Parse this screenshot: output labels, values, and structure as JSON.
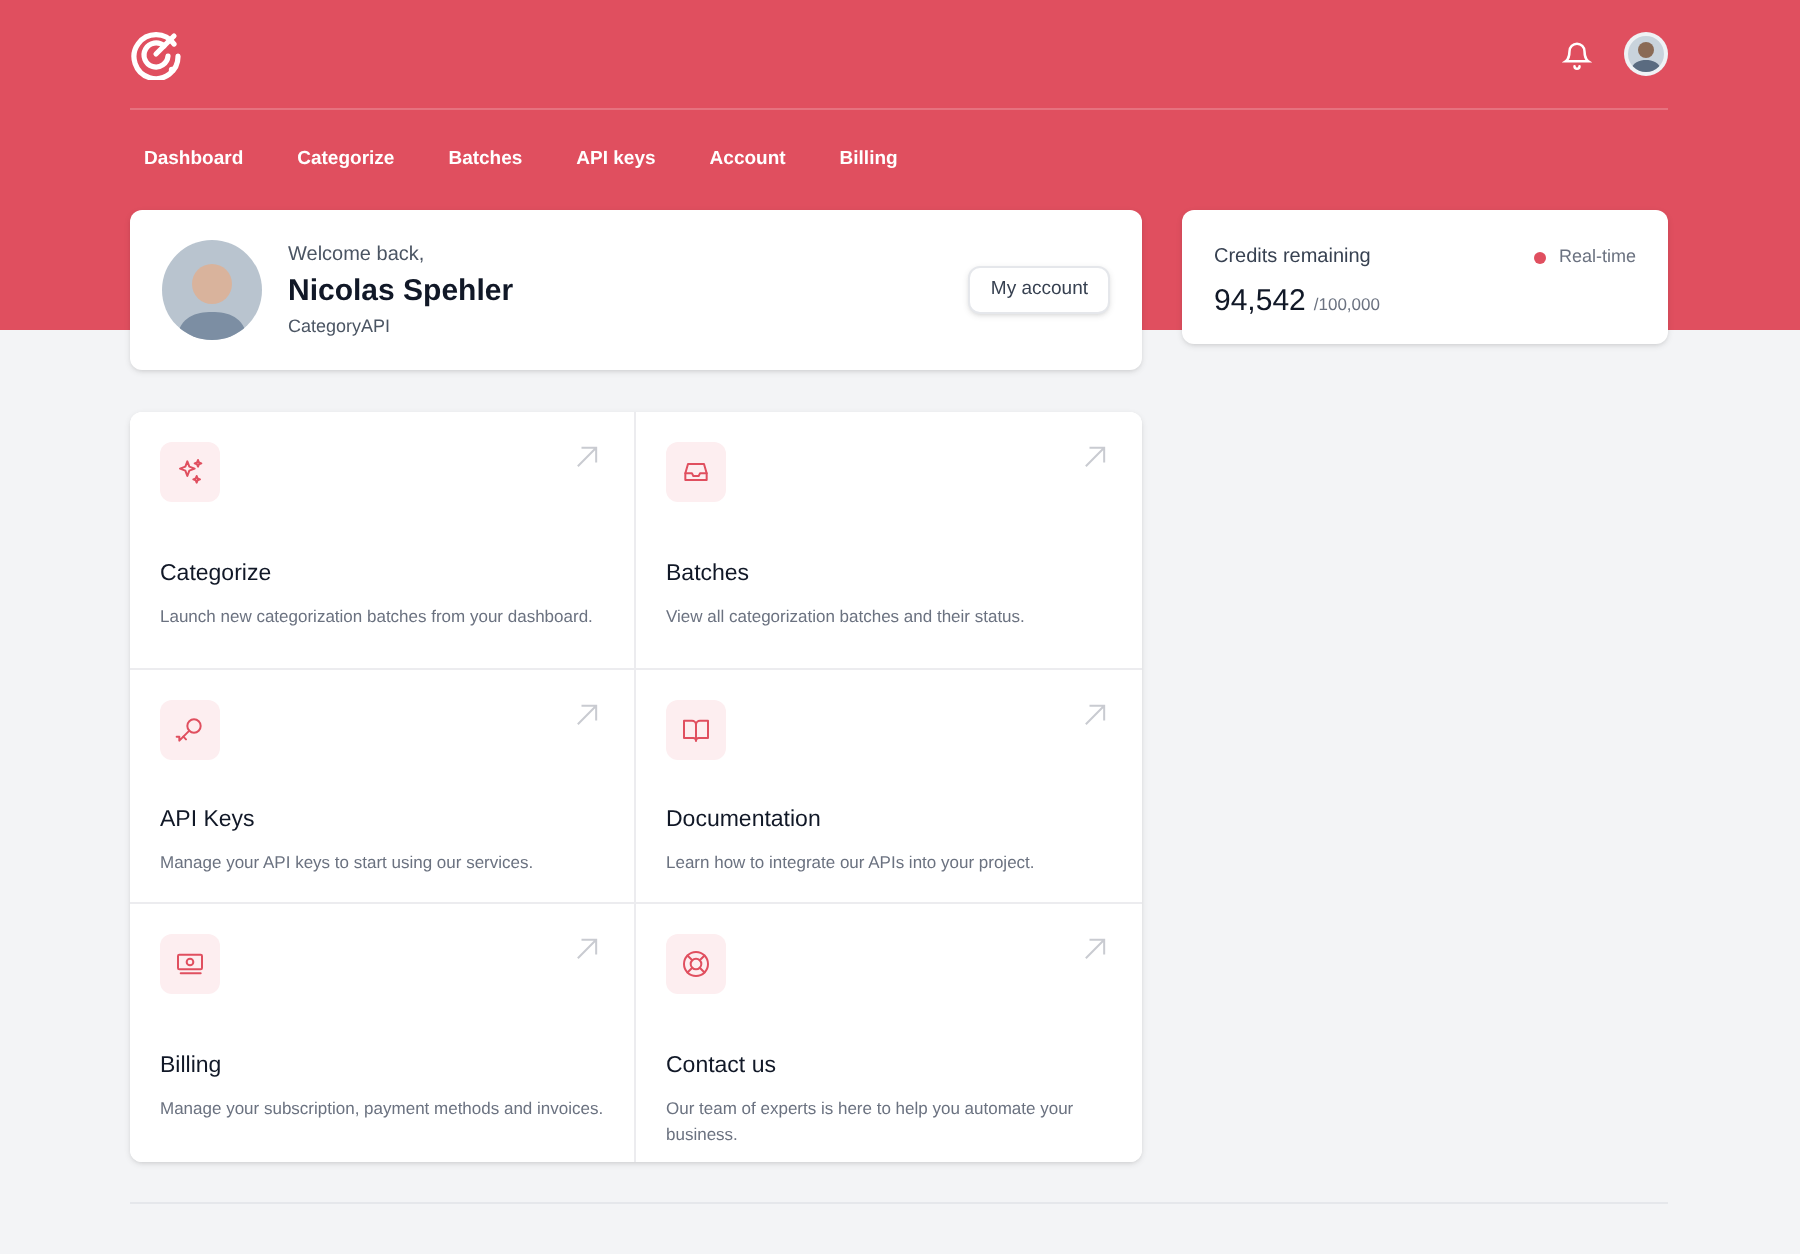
{
  "nav": [
    {
      "label": "Dashboard"
    },
    {
      "label": "Categorize"
    },
    {
      "label": "Batches"
    },
    {
      "label": "API keys"
    },
    {
      "label": "Account"
    },
    {
      "label": "Billing"
    }
  ],
  "profile": {
    "greeting": "Welcome back,",
    "name": "Nicolas Spehler",
    "company": "CategoryAPI",
    "button": "My account"
  },
  "credits": {
    "title": "Credits remaining",
    "status": "Real-time",
    "value": "94,542",
    "total": "/100,000"
  },
  "tiles": [
    {
      "title": "Categorize",
      "description": "Launch new categorization batches from your dashboard."
    },
    {
      "title": "Batches",
      "description": "View all categorization batches and their status."
    },
    {
      "title": "API Keys",
      "description": "Manage your API keys to start using our services."
    },
    {
      "title": "Documentation",
      "description": "Learn how to integrate our APIs into your project."
    },
    {
      "title": "Billing",
      "description": "Manage your subscription, payment methods and invoices."
    },
    {
      "title": "Contact us",
      "description": "Our team of experts is here to help you automate your business."
    }
  ]
}
